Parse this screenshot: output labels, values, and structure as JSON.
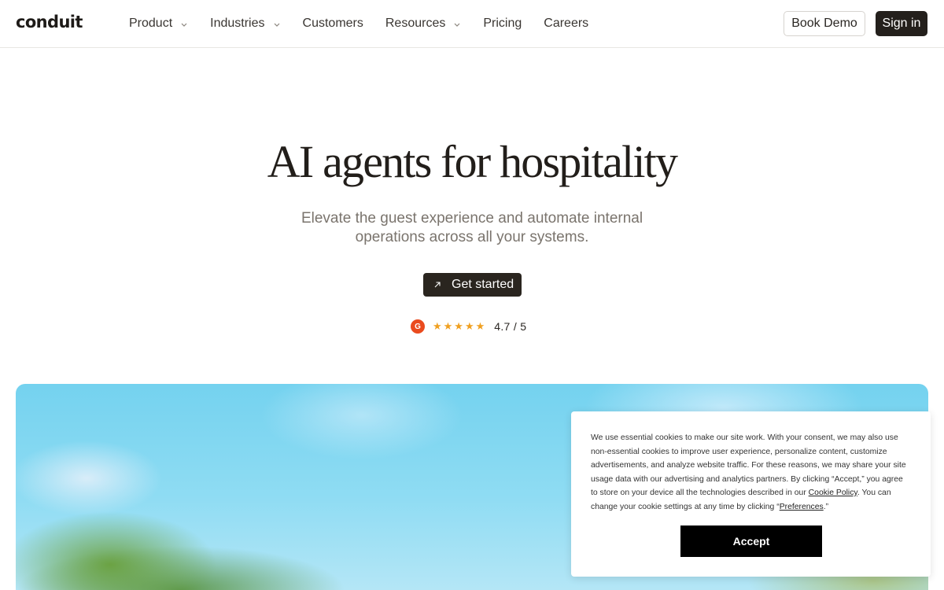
{
  "nav": {
    "logo": "conduit",
    "items": [
      {
        "label": "Product",
        "has_dropdown": true
      },
      {
        "label": "Industries",
        "has_dropdown": true
      },
      {
        "label": "Customers",
        "has_dropdown": false
      },
      {
        "label": "Resources",
        "has_dropdown": true
      },
      {
        "label": "Pricing",
        "has_dropdown": false
      },
      {
        "label": "Careers",
        "has_dropdown": false
      }
    ],
    "book_demo_label": "Book Demo",
    "sign_in_label": "Sign in"
  },
  "hero": {
    "title": "AI agents for hospitality",
    "subtitle": "Elevate the guest experience and automate internal operations across all your systems.",
    "cta_label": "Get started",
    "cta_icon": "arrow-up-right-icon",
    "rating": {
      "badge": "G",
      "badge_icon": "g2-logo-icon",
      "stars": "★★★★★",
      "score": "4.7 / 5"
    }
  },
  "cookie_banner": {
    "text_1": "We use essential cookies to make our site work. With your consent, we may also use non-essential cookies to improve user experience, personalize content, customize advertisements, and analyze website traffic. For these reasons, we may share your site usage data with our advertising and analytics partners. By clicking “Accept,” you agree to store on your device all the technologies described in our ",
    "cookie_policy_link": "Cookie Policy",
    "text_2": ". You can change your cookie settings at any time by clicking “",
    "preferences_link": "Preferences",
    "text_3": ".”",
    "accept_label": "Accept"
  },
  "colors": {
    "primary_dark": "#24201c",
    "star": "#f0a020",
    "g2_badge": "#ea4b1e",
    "sky": "#74d2ef"
  }
}
